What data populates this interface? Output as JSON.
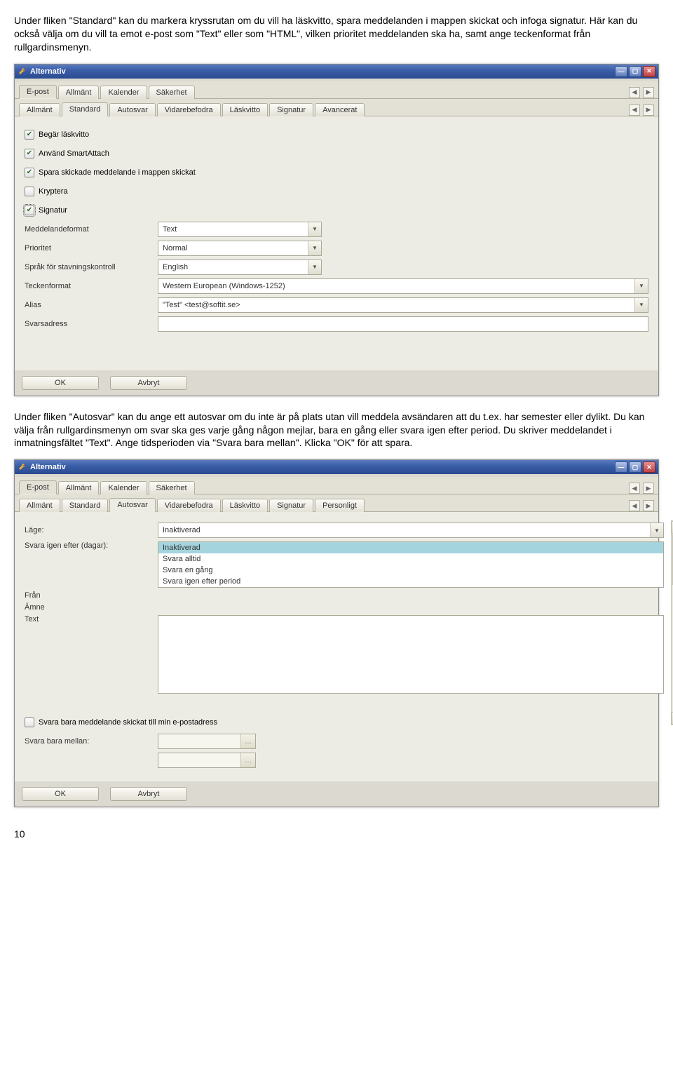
{
  "intro1": "Under fliken \"Standard\" kan du markera kryssrutan om du vill ha läskvitto, spara meddelanden i mappen skickat och infoga signatur. Här kan du också välja om du vill ta emot e-post som \"Text\" eller som \"HTML\", vilken prioritet meddelanden ska ha, samt ange teckenformat från rullgardinsmenyn.",
  "intro2": "Under fliken  \"Autosvar\" kan du ange ett autosvar om du inte är på plats utan vill meddela avsändaren att du t.ex. har semester eller dylikt.  Du kan välja från rullgardinsmenyn om svar ska ges varje gång någon mejlar, bara en gång eller svara igen efter period. Du skriver meddelandet i inmatningsfältet \"Text\". Ange tidsperioden via \"Svara bara mellan\". Klicka \"OK\" för att spara.",
  "window_title": "Alternativ",
  "top_tabs": [
    "E-post",
    "Allmänt",
    "Kalender",
    "Säkerhet"
  ],
  "sub_tabs1": [
    "Allmänt",
    "Standard",
    "Autosvar",
    "Vidarebefodra",
    "Läskvitto",
    "Signatur",
    "Avancerat"
  ],
  "sub_tabs2": [
    "Allmänt",
    "Standard",
    "Autosvar",
    "Vidarebefodra",
    "Läskvitto",
    "Signatur",
    "Personligt"
  ],
  "checks": {
    "laskvitto": "Begär läskvitto",
    "smartattach": "Använd SmartAttach",
    "spara": "Spara skickade meddelande i mappen skickat",
    "kryptera": "Kryptera",
    "signatur": "Signatur"
  },
  "labels": {
    "meddelandeformat": "Meddelandeformat",
    "prioritet": "Prioritet",
    "sprak": "Språk för stavningskontroll",
    "teckenformat": "Teckenformat",
    "alias": "Alias",
    "svarsadress": "Svarsadress",
    "lage": "Läge:",
    "svara_igen": "Svara igen efter (dagar):",
    "fran": "Från",
    "amne": "Ämne",
    "text": "Text",
    "svara_bara_chk": "Svara bara meddelande skickat till min e-postadress",
    "svara_bara_mellan": "Svara bara mellan:"
  },
  "values": {
    "meddelandeformat": "Text",
    "prioritet": "Normal",
    "sprak": "English",
    "teckenformat": "Western European (Windows-1252)",
    "alias": "\"Test\" <test@softit.se>",
    "svarsadress": "",
    "lage": "Inaktiverad"
  },
  "lage_options": [
    "Inaktiverad",
    "Svara alltid",
    "Svara en gång",
    "Svara igen efter period"
  ],
  "buttons": {
    "ok": "OK",
    "avbryt": "Avbryt"
  },
  "page_number": "10"
}
